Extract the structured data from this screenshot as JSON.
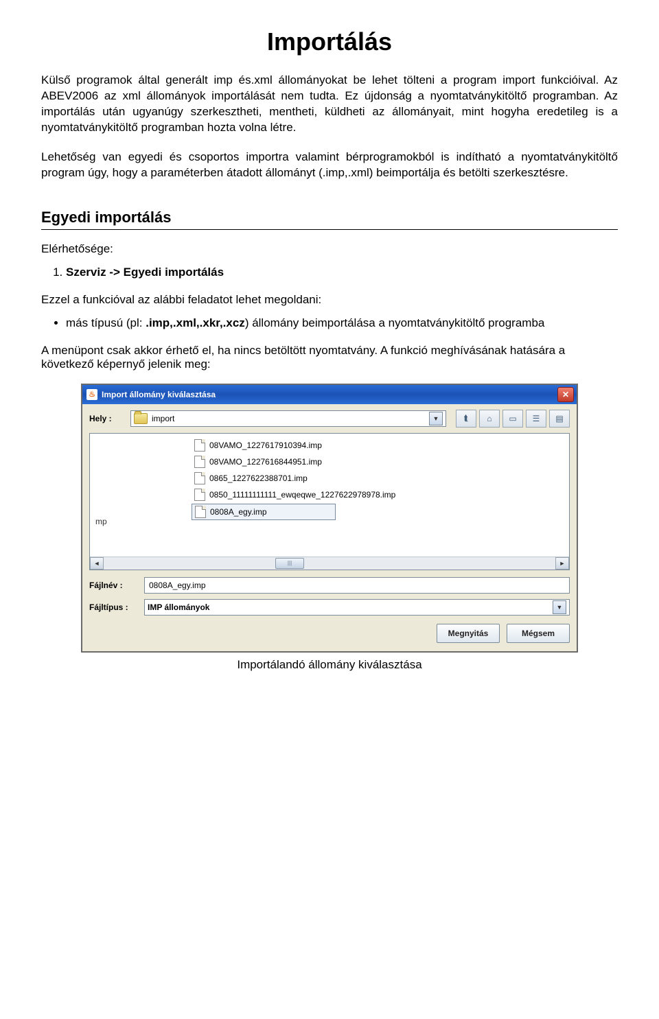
{
  "doc": {
    "title": "Importálás",
    "para1": "Külső programok által generált imp és.xml állományokat be lehet tölteni a program import funkcióival. Az ABEV2006 az xml állományok importálását nem tudta. Ez újdonság a nyomtatványkitöltő programban. Az importálás után ugyanúgy szerkesztheti, mentheti, küldheti az állományait, mint hogyha eredetileg is a nyomtatványkitöltő programban hozta volna létre.",
    "para2": "Lehetőség van egyedi és csoportos importra valamint bérprogramokból is indítható a nyomtatványkitöltő program úgy, hogy a paraméterben átadott állományt (.imp,.xml) beimportálja és betölti szerkesztésre.",
    "section_h": "Egyedi importálás",
    "reach_label": "Elérhetősége:",
    "step1_bold": "Szerviz -> Egyedi importálás",
    "intro": "Ezzel a funkcióval az alábbi feladatot lehet megoldani:",
    "bullet_pre": "más típusú (pl:",
    "bullet_bold": ".imp,.xml,.xkr,.xcz",
    "bullet_post": ") állomány beimportálása a nyomtatványkitöltő programba",
    "after": "A menüpont csak akkor érhető el, ha nincs betöltött nyomtatvány. A funkció meghívásának hatására a következő képernyő jelenik meg:",
    "caption": "Importálandó állomány kiválasztása"
  },
  "dialog": {
    "title": "Import állomány kiválasztása",
    "location_label": "Hely :",
    "location_value": "import",
    "left_col_text": "mp",
    "files": [
      "08VAMO_1227617910394.imp",
      "08VAMO_1227616844951.imp",
      "0865_1227622388701.imp",
      "0850_11111111111_ewqeqwe_1227622978978.imp",
      "0808A_egy.imp"
    ],
    "selected_index": 4,
    "filename_label": "Fájlnév :",
    "filename_value": "0808A_egy.imp",
    "filetype_label": "Fájltípus :",
    "filetype_value": "IMP állományok",
    "open_btn": "Megnyitás",
    "cancel_btn": "Mégsem"
  }
}
